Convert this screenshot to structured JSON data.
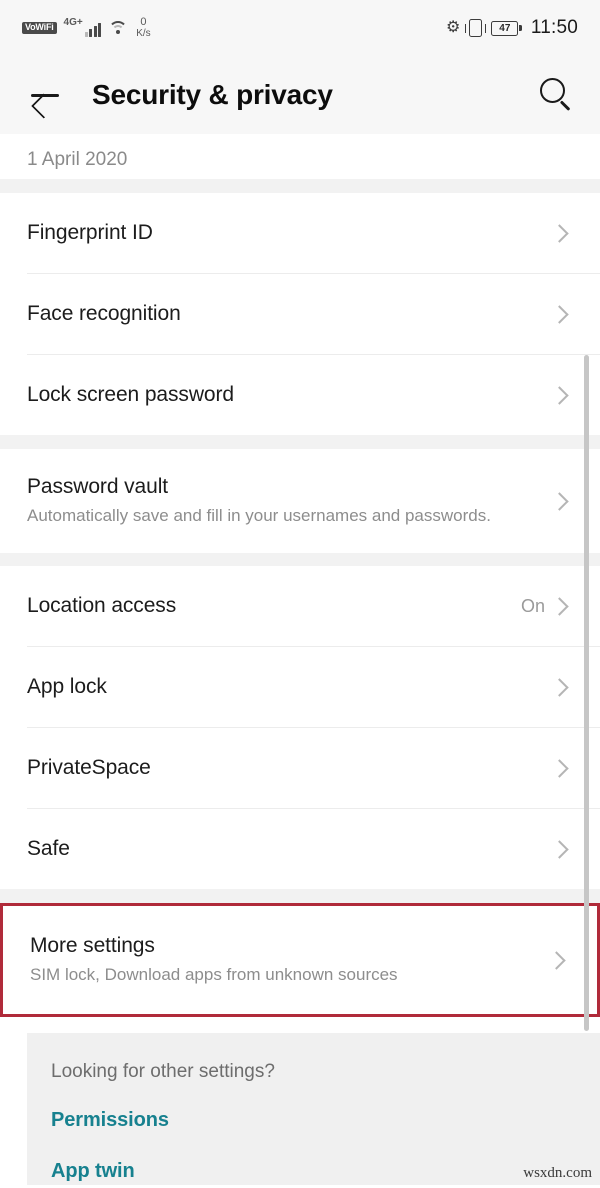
{
  "status_bar": {
    "vowifi_label": "VoWiFi",
    "network_label": "4G+",
    "speed_value": "0",
    "speed_unit": "K/s",
    "bluetooth_icon": "bluetooth-icon",
    "vibrate_icon": "vibrate-icon",
    "battery_percent": "47",
    "time": "11:50"
  },
  "header": {
    "back_icon": "back-arrow-icon",
    "title": "Security & privacy",
    "search_icon": "search-icon"
  },
  "content": {
    "date_row": "1 April 2020",
    "groups": [
      {
        "items": [
          {
            "title": "Fingerprint ID",
            "subtitle": "",
            "value": ""
          },
          {
            "title": "Face recognition",
            "subtitle": "",
            "value": ""
          },
          {
            "title": "Lock screen password",
            "subtitle": "",
            "value": ""
          }
        ]
      },
      {
        "items": [
          {
            "title": "Password vault",
            "subtitle": "Automatically save and fill in your usernames and passwords.",
            "value": ""
          }
        ]
      },
      {
        "items": [
          {
            "title": "Location access",
            "subtitle": "",
            "value": "On"
          },
          {
            "title": "App lock",
            "subtitle": "",
            "value": ""
          },
          {
            "title": "PrivateSpace",
            "subtitle": "",
            "value": ""
          },
          {
            "title": "Safe",
            "subtitle": "",
            "value": ""
          }
        ]
      }
    ],
    "highlighted_item": {
      "title": "More settings",
      "subtitle": "SIM lock, Download apps from unknown sources",
      "highlight_color": "#b02a3a"
    },
    "other_settings": {
      "question": "Looking for other settings?",
      "links": [
        "Permissions",
        "App twin"
      ],
      "link_color": "#17818f"
    }
  },
  "watermark": "wsxdn.com"
}
